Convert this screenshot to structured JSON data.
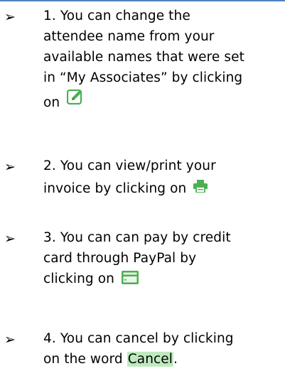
{
  "bullet_glyph": "➢",
  "items": [
    {
      "lines": [
        "1. You can change the",
        "attendee name from your",
        "available names that were set",
        "in “My Associates” by clicking",
        "on"
      ],
      "icon": "edit-icon"
    },
    {
      "lines": [
        "2. You can view/print your",
        "invoice by clicking on"
      ],
      "icon": "print-icon"
    },
    {
      "lines": [
        "3. You can can pay by credit",
        "card through PayPal by",
        "clicking on"
      ],
      "icon": "credit-card-icon"
    },
    {
      "lines": [
        "4. You can cancel by clicking",
        "on the word"
      ],
      "cancel_word": "Cancel",
      "trailing": "."
    }
  ],
  "colors": {
    "top_rule": "#4f81bd",
    "icon_green": "#4caf50",
    "cancel_highlight": "#bfeabf"
  }
}
